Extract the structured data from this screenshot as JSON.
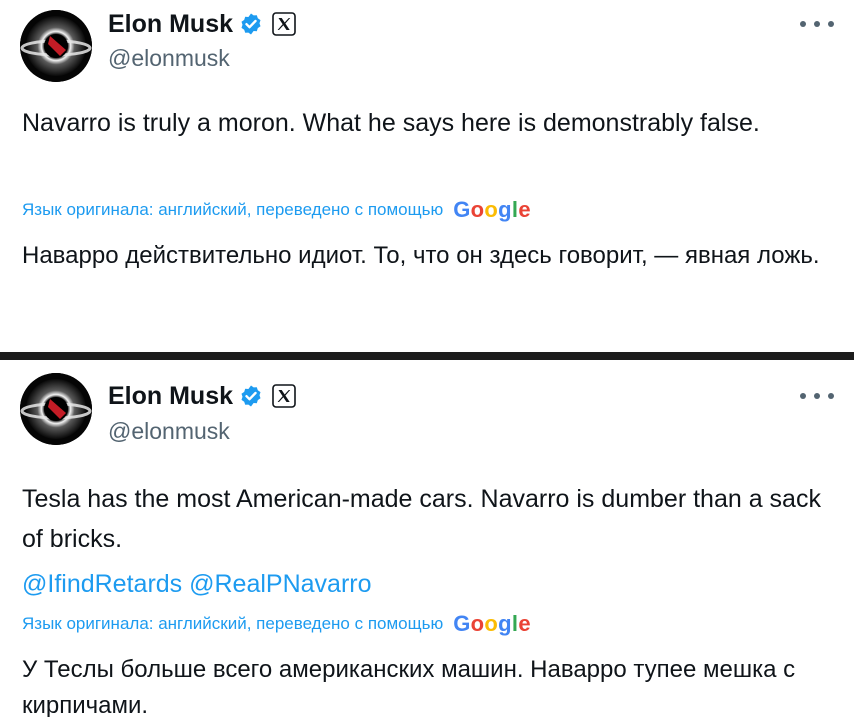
{
  "tweets": [
    {
      "author": {
        "name": "Elon Musk",
        "handle": "@elonmusk",
        "verified_icon": "verified-badge-icon",
        "affiliation_icon": "x-logo-icon"
      },
      "text": "Navarro is truly a moron. What he says here is demonstrably false.",
      "translation_label": "Язык оригинала: английский, переведено с помощью",
      "translation_provider": [
        "G",
        "o",
        "o",
        "g",
        "l",
        "e"
      ],
      "translated_text": "Наварро действительно идиот. То, что он здесь говорит, — явная ложь."
    },
    {
      "author": {
        "name": "Elon Musk",
        "handle": "@elonmusk",
        "verified_icon": "verified-badge-icon",
        "affiliation_icon": "x-logo-icon"
      },
      "text": "Tesla has the most American-made cars. Navarro is dumber than a sack of bricks.",
      "mentions": [
        "@IfindRetards",
        "@RealPNavarro"
      ],
      "translation_label": "Язык оригинала: английский, переведено с помощью",
      "translation_provider": [
        "G",
        "o",
        "o",
        "g",
        "l",
        "e"
      ],
      "translated_text": "У Теслы больше всего американских машин. Наварро тупее мешка с кирпичами."
    }
  ],
  "colors": {
    "text": "#0f1419",
    "secondary": "#536471",
    "link": "#1d9bf0",
    "verified": "#1d9bf0",
    "divider": "#1c1c1c",
    "google_blue": "#4285f4",
    "google_red": "#ea4335",
    "google_yellow": "#fbbc05",
    "google_green": "#34a853"
  }
}
